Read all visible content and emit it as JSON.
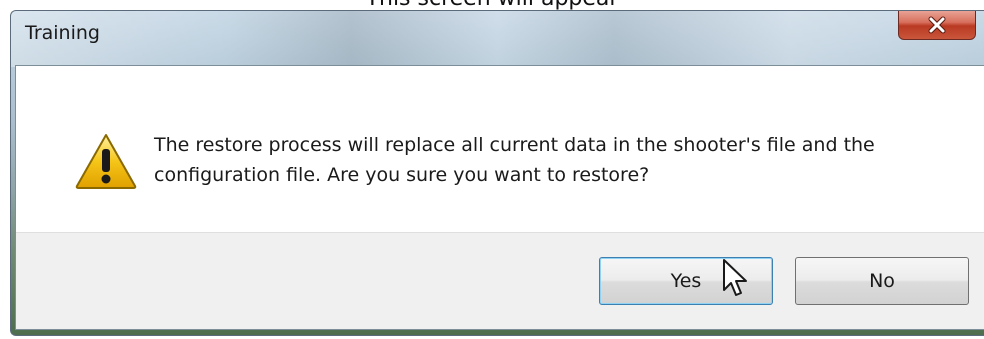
{
  "caption": "This screen will appear",
  "window": {
    "title": "Training",
    "close_icon": "close-x-icon"
  },
  "dialog": {
    "icon": "warning-triangle-icon",
    "message": "The restore process will replace all current data in the shooter's file and the configuration file. Are you sure you want to restore?",
    "buttons": {
      "yes_label": "Yes",
      "no_label": "No"
    }
  },
  "colors": {
    "close_button": "#c9563b",
    "warning_yellow": "#f5c518",
    "focus_border": "#3c7fb1"
  }
}
